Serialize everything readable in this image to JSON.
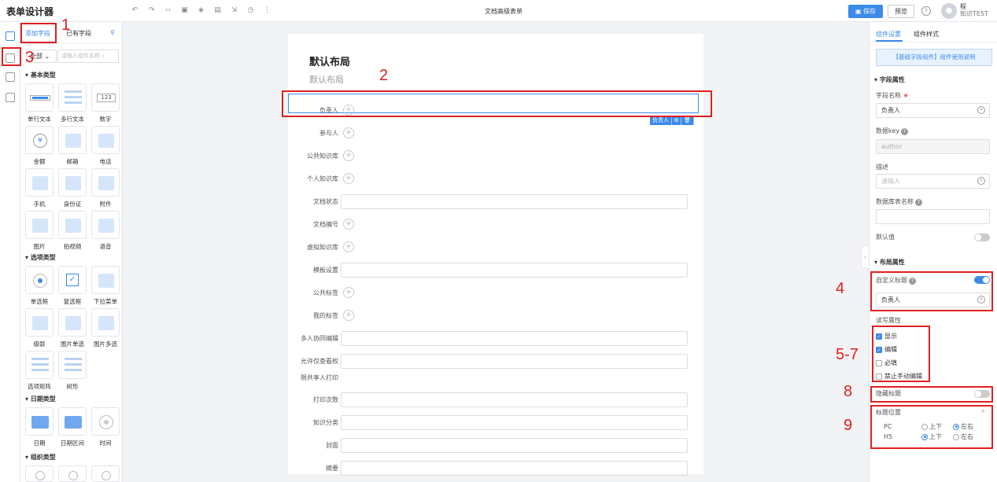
{
  "header": {
    "app_title": "表单设计器",
    "doc_title": "文档高级表单",
    "save_label": "保存",
    "preview_label": "预览",
    "avatar_text": "程",
    "user_name": "程",
    "user_org": "知识TEST",
    "toolbar_icons": [
      "undo-icon",
      "redo-icon",
      "code-icon",
      "layout-icon",
      "layers-icon",
      "grid-icon",
      "import-icon",
      "history-icon",
      "more-icon"
    ]
  },
  "components": {
    "tab_add": "添加字段",
    "tab_existing": "已有字段",
    "filter_value": "全部",
    "search_placeholder": "请输入组件名称",
    "sections": [
      {
        "title": "基本类型",
        "items": [
          "单行文本",
          "多行文本",
          "数字",
          "金额",
          "邮箱",
          "电话",
          "手机",
          "身份证",
          "附件",
          "图片",
          "拍视频",
          "语音"
        ]
      },
      {
        "title": "选项类型",
        "items": [
          "单选框",
          "复选框",
          "下拉菜单",
          "级联",
          "图片单选",
          "图片多选",
          "选项矩阵",
          "树形"
        ]
      },
      {
        "title": "日期类型",
        "items": [
          "日期",
          "日期区间",
          "时间"
        ]
      },
      {
        "title": "组织类型",
        "items": []
      }
    ],
    "number_glyph": "123",
    "money_glyph": "¥"
  },
  "form": {
    "title": "默认布局",
    "subtitle": "默认布局",
    "fields": [
      {
        "label": "负责人",
        "kind": "plus"
      },
      {
        "label": "参与人",
        "kind": "plus"
      },
      {
        "label": "公共知识库",
        "kind": "plus"
      },
      {
        "label": "个人知识库",
        "kind": "plus"
      },
      {
        "label": "文档状态",
        "kind": "input"
      },
      {
        "label": "文档编号",
        "kind": "plus"
      },
      {
        "label": "虚拟知识库",
        "kind": "plus"
      },
      {
        "label": "模板设置",
        "kind": "input"
      },
      {
        "label": "公共标签",
        "kind": "plus"
      },
      {
        "label": "我的标签",
        "kind": "plus"
      },
      {
        "label": "多人协同编辑",
        "kind": "input"
      },
      {
        "label": "允许仅查看权",
        "kind": "input"
      },
      {
        "label": "限共享人打印",
        "kind": "none"
      },
      {
        "label": "打印次数",
        "kind": "input"
      },
      {
        "label": "知识分类",
        "kind": "input"
      },
      {
        "label": "封面",
        "kind": "input"
      },
      {
        "label": "摘要",
        "kind": "input"
      }
    ],
    "selected_tag": "负责人"
  },
  "props": {
    "tab_component": "组件设置",
    "tab_style": "组件样式",
    "usage_note": "【基础字段组件】组件使用说明",
    "field_section": "字段属性",
    "field_name_label": "字段名称",
    "field_name_value": "负责人",
    "data_key_label": "数据key",
    "data_key_value": "author",
    "desc_label": "描述",
    "desc_placeholder": "请输入",
    "db_name_label": "数据库表名称",
    "db_name_value": "",
    "default_label": "默认值",
    "default_on": false,
    "layout_section": "布局属性",
    "custom_title_label": "自定义标题",
    "custom_title_on": true,
    "custom_title_value": "负责人",
    "rw_label": "读写属性",
    "rw_options": [
      {
        "label": "显示",
        "checked": true
      },
      {
        "label": "编辑",
        "checked": true
      },
      {
        "label": "必填",
        "checked": false
      },
      {
        "label": "禁止手动编辑",
        "checked": false
      }
    ],
    "hide_title_label": "隐藏标题",
    "hide_title_on": false,
    "title_pos_label": "标题位置",
    "pos_pc_label": "PC",
    "pos_h5_label": "H5",
    "pos_top": "上下",
    "pos_lr": "左右",
    "pc_selected": "左右",
    "h5_selected": "上下"
  },
  "annotations": [
    "1",
    "2",
    "3",
    "4",
    "5-7",
    "8",
    "9"
  ],
  "colors": {
    "accent": "#3b8beb",
    "annotation": "#e02020"
  }
}
